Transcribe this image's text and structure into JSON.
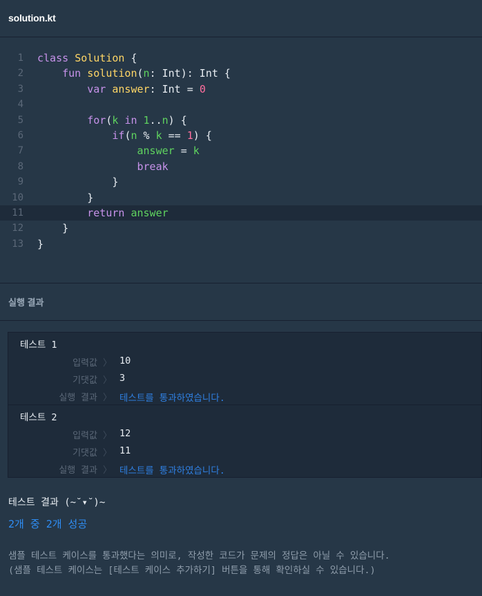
{
  "tab": {
    "title": "solution.kt"
  },
  "editor": {
    "active_line": 11,
    "lines": [
      {
        "n": "1",
        "tokens": [
          [
            "pur",
            "class "
          ],
          [
            "ylw",
            "Solution"
          ],
          [
            "plain",
            " {"
          ]
        ]
      },
      {
        "n": "2",
        "tokens": [
          [
            "plain",
            "    "
          ],
          [
            "pur",
            "fun "
          ],
          [
            "ylw",
            "solution"
          ],
          [
            "plain",
            "("
          ],
          [
            "grn",
            "n"
          ],
          [
            "plain",
            ": Int): Int {"
          ]
        ]
      },
      {
        "n": "3",
        "tokens": [
          [
            "plain",
            "        "
          ],
          [
            "pur",
            "var "
          ],
          [
            "ylw",
            "answer"
          ],
          [
            "plain",
            ": Int = "
          ],
          [
            "pnk",
            "0"
          ]
        ]
      },
      {
        "n": "4",
        "tokens": []
      },
      {
        "n": "5",
        "tokens": [
          [
            "plain",
            "        "
          ],
          [
            "pur",
            "for"
          ],
          [
            "plain",
            "("
          ],
          [
            "grn",
            "k"
          ],
          [
            "plain",
            " "
          ],
          [
            "pur",
            "in"
          ],
          [
            "plain",
            " "
          ],
          [
            "grn",
            "1"
          ],
          [
            "plain",
            ".."
          ],
          [
            "grn",
            "n"
          ],
          [
            "plain",
            ") {"
          ]
        ]
      },
      {
        "n": "6",
        "tokens": [
          [
            "plain",
            "            "
          ],
          [
            "pur",
            "if"
          ],
          [
            "plain",
            "("
          ],
          [
            "grn",
            "n"
          ],
          [
            "plain",
            " % "
          ],
          [
            "grn",
            "k"
          ],
          [
            "plain",
            " == "
          ],
          [
            "pnk",
            "1"
          ],
          [
            "plain",
            ") {"
          ]
        ]
      },
      {
        "n": "7",
        "tokens": [
          [
            "plain",
            "                "
          ],
          [
            "grn",
            "answer"
          ],
          [
            "plain",
            " = "
          ],
          [
            "grn",
            "k"
          ]
        ]
      },
      {
        "n": "8",
        "tokens": [
          [
            "plain",
            "                "
          ],
          [
            "pur",
            "break"
          ]
        ]
      },
      {
        "n": "9",
        "tokens": [
          [
            "plain",
            "            }"
          ]
        ]
      },
      {
        "n": "10",
        "tokens": [
          [
            "plain",
            "        }"
          ]
        ]
      },
      {
        "n": "11",
        "tokens": [
          [
            "plain",
            "        "
          ],
          [
            "pur",
            "return"
          ],
          [
            "plain",
            " "
          ],
          [
            "grn",
            "answer"
          ]
        ]
      },
      {
        "n": "12",
        "tokens": [
          [
            "plain",
            "    }"
          ]
        ]
      },
      {
        "n": "13",
        "tokens": [
          [
            "plain",
            "}"
          ]
        ]
      }
    ]
  },
  "results": {
    "header": "실행 결과",
    "arrow": "〉",
    "tests": [
      {
        "title": "테스트 1",
        "input_label": "입력값",
        "input_value": "10",
        "expected_label": "기댓값",
        "expected_value": "3",
        "result_label": "실행 결과",
        "result_value": "테스트를 통과하였습니다."
      },
      {
        "title": "테스트 2",
        "input_label": "입력값",
        "input_value": "12",
        "expected_label": "기댓값",
        "expected_value": "11",
        "result_label": "실행 결과",
        "result_value": "테스트를 통과하였습니다."
      }
    ],
    "summary_title": "테스트 결과 (~˘▾˘)~",
    "summary_result": "2개 중 2개 성공",
    "notice_line1": "샘플 테스트 케이스를 통과했다는 의미로, 작성한 코드가 문제의 정답은 아닐 수 있습니다.",
    "notice_line2": "(샘플 테스트 케이스는 [테스트 케이스 추가하기] 버튼을 통해 확인하실 수 있습니다.)"
  },
  "colors": {
    "background": "#263747",
    "panel": "#1e2b3a",
    "pass": "#2f7fe0",
    "keyword": "#c792ea",
    "identifier": "#5fd35f",
    "classname": "#ffd666",
    "number": "#ff6e9e"
  }
}
